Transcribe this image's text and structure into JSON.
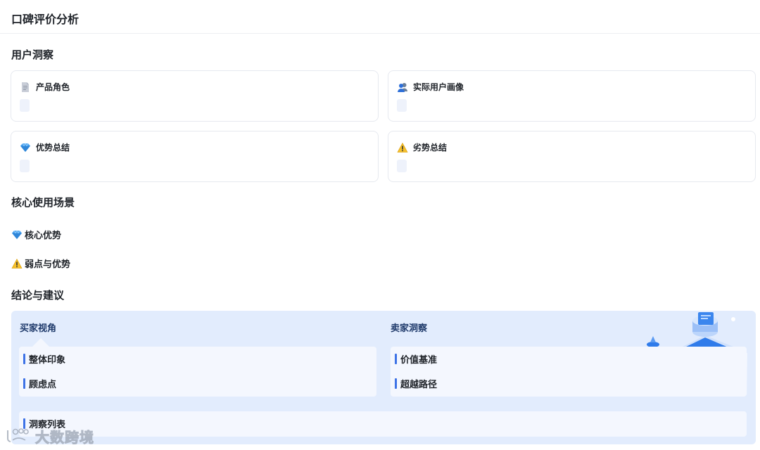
{
  "header": {
    "title": "口碑评价分析"
  },
  "user_insight": {
    "title": "用户洞察",
    "cards": [
      {
        "label": "产品角色",
        "icon": "document-icon"
      },
      {
        "label": "实际用户画像",
        "icon": "users-icon"
      },
      {
        "label": "优势总结",
        "icon": "gem-icon"
      },
      {
        "label": "劣势总结",
        "icon": "warning-icon"
      }
    ]
  },
  "core_scenes": {
    "title": "核心使用场景",
    "items": [
      {
        "label": "核心优势",
        "icon": "gem-icon"
      },
      {
        "label": "弱点与优势",
        "icon": "warning-icon"
      }
    ]
  },
  "conclusion": {
    "title": "结论与建议",
    "buyer": {
      "title": "买家视角",
      "items": [
        "整体印象",
        "顾虑点"
      ]
    },
    "seller": {
      "title": "卖家洞察",
      "items": [
        "价值基准",
        "超越路径"
      ]
    },
    "insight_list": {
      "label": "洞察列表"
    }
  },
  "watermark": {
    "text": "大数跨境"
  },
  "colors": {
    "accent": "#3d72e6",
    "panel_bg": "#e2ecfd",
    "card_border": "#e6e9ef"
  }
}
